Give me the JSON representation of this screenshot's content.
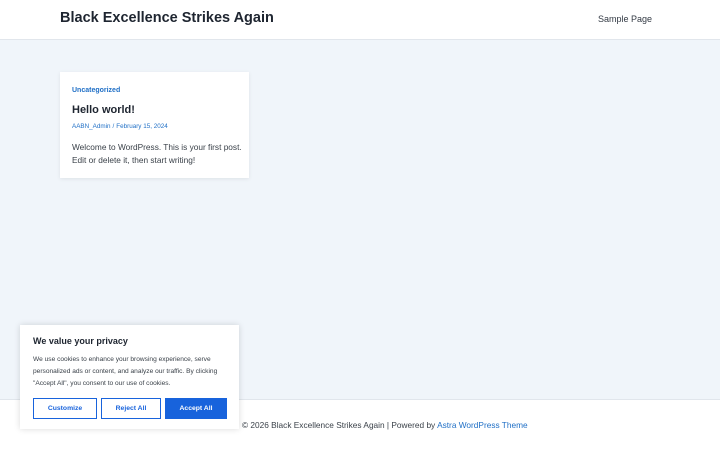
{
  "header": {
    "site_title": "Black Excellence Strikes Again",
    "nav_items": [
      "Sample Page"
    ]
  },
  "post": {
    "category": "Uncategorized",
    "title": "Hello world!",
    "author": "AABN_Admin",
    "separator": "/",
    "date": "February 15, 2024",
    "excerpt": "Welcome to WordPress. This is your first post. Edit or delete it, then start writing!"
  },
  "footer": {
    "copyright": "© 2026 Black Excellence Strikes Again | Powered by ",
    "theme_link": "Astra WordPress Theme"
  },
  "cookie_banner": {
    "title": "We value your privacy",
    "description": "We use cookies to enhance your browsing experience, serve personalized ads or content, and analyze our traffic. By clicking \"Accept All\", you consent to our use of cookies.",
    "customize_label": "Customize",
    "reject_label": "Reject All",
    "accept_label": "Accept All"
  },
  "colors": {
    "accent": "#1f6fc6",
    "button_primary": "#1863dc",
    "page_background": "#f0f5fa"
  }
}
